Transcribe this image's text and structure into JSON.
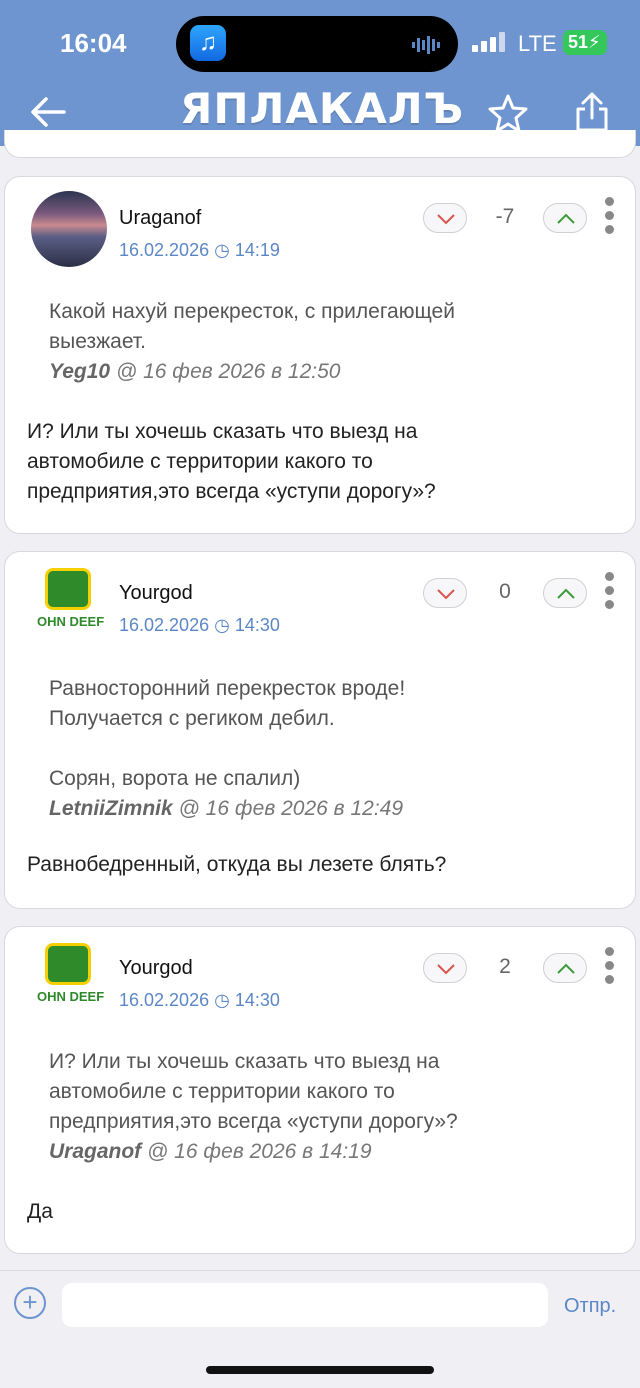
{
  "status_bar": {
    "time": "16:04",
    "network": "LTE",
    "battery": "51"
  },
  "app": {
    "logo": "ЯПЛАКАЛЪ"
  },
  "colors": {
    "header": "#6e95cf",
    "accent": "#5b87c7",
    "vote_down": "#d9534f",
    "vote_up": "#3c9a3c"
  },
  "comments": [
    {
      "username": "Uraganof",
      "date": "16.02.2026",
      "time": "14:19",
      "score": "-7",
      "quote_lines": [
        "Какой нахуй перекресток, с прилегающей",
        "выезжает."
      ],
      "quote_author": "Yeg10",
      "quote_meta": "@ 16 фев 2026 в 12:50",
      "body_lines": [
        "И? Или ты хочешь сказать что выезд на",
        "автомобиле   с территории какого то",
        "предприятия,это всегда «уступи дорогу»?"
      ]
    },
    {
      "username": "Yourgod",
      "avatar_text": "ОHN DEEF",
      "date": "16.02.2026",
      "time": "14:30",
      "score": "0",
      "quote_lines": [
        "Равносторонний перекресток вроде!",
        "Получается с региком дебил.",
        "",
        "Сорян, ворота не спалил)"
      ],
      "quote_author": "LetniiZimnik",
      "quote_meta": "@ 16 фев 2026 в 12:49",
      "body_lines": [
        "Равнобедренный, откуда вы лезете блять?"
      ]
    },
    {
      "username": "Yourgod",
      "avatar_text": "ОHN DEEF",
      "date": "16.02.2026",
      "time": "14:30",
      "score": "2",
      "quote_lines": [
        "И? Или ты хочешь сказать что выезд на",
        "автомобиле   с территории какого то",
        "предприятия,это всегда «уступи дорогу»?"
      ],
      "quote_author": "Uraganof",
      "quote_meta": "@ 16 фев 2026 в 14:19",
      "body_lines": [
        "Да"
      ]
    }
  ],
  "composer": {
    "placeholder": "",
    "send_label": "Отпр."
  }
}
